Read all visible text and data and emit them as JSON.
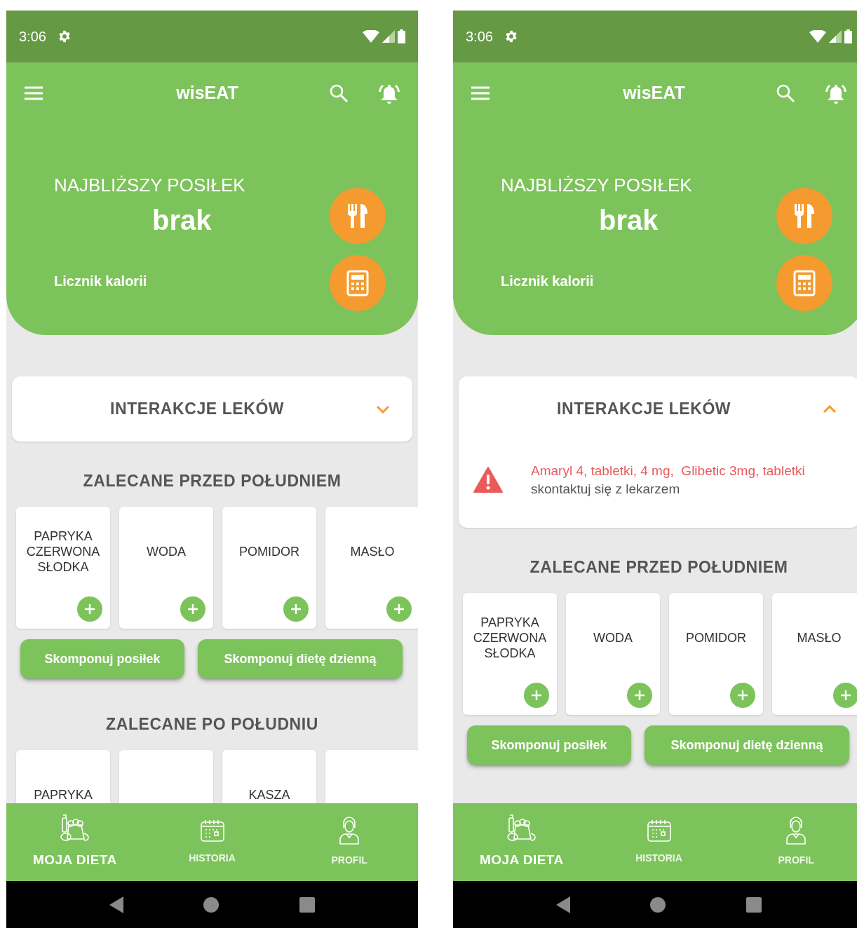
{
  "screens": [
    {
      "status_bar": {
        "time": "3:06"
      },
      "app_bar": {
        "title": "wisEAT"
      },
      "next_meal": {
        "label": "NAJBLIŻSZY POSIŁEK",
        "value": "brak"
      },
      "calorie_counter": {
        "label": "Licznik kalorii"
      },
      "drug_interactions": {
        "title": "INTERAKCJE LEKÓW",
        "expanded": false
      },
      "sections": [
        {
          "title": "ZALECANE PRZED POŁUDNIEM",
          "foods": [
            {
              "kind": "food",
              "name": "PAPRYKA CZERWONA SŁODKA"
            },
            {
              "kind": "food",
              "name": "WODA"
            },
            {
              "kind": "food",
              "name": "POMIDOR"
            },
            {
              "kind": "food",
              "name": "MASŁO"
            }
          ],
          "buttons": [
            "Skomponuj posiłek",
            "Skomponuj dietę dzienną"
          ]
        },
        {
          "title": "ZALECANE PO POŁUDNIU",
          "foods": [
            {
              "kind": "partial",
              "name": "PAPRYKA"
            },
            {
              "kind": "partial"
            },
            {
              "kind": "partial",
              "name": "KASZA"
            },
            {
              "kind": "partial"
            }
          ]
        }
      ],
      "bottom_nav": [
        {
          "label": "MOJA DIETA",
          "selected": true
        },
        {
          "label": "HISTORIA",
          "selected": false
        },
        {
          "label": "PROFIL",
          "selected": false
        }
      ]
    },
    {
      "status_bar": {
        "time": "3:06"
      },
      "app_bar": {
        "title": "wisEAT"
      },
      "next_meal": {
        "label": "NAJBLIŻSZY POSIŁEK",
        "value": "brak"
      },
      "calorie_counter": {
        "label": "Licznik kalorii"
      },
      "drug_interactions": {
        "title": "INTERAKCJE LEKÓW",
        "expanded": true,
        "warnings": [
          {
            "drugs": "Amaryl 4, tabletki, 4 mg,  Glibetic 3mg, tabletki",
            "advice": "skontaktuj się z lekarzem"
          }
        ]
      },
      "sections": [
        {
          "title": "ZALECANE PRZED POŁUDNIEM",
          "foods": [
            {
              "kind": "food",
              "name": "PAPRYKA CZERWONA SŁODKA"
            },
            {
              "kind": "food",
              "name": "WODA"
            },
            {
              "kind": "food",
              "name": "POMIDOR"
            },
            {
              "kind": "food",
              "name": "MASŁO"
            }
          ],
          "buttons": [
            "Skomponuj posiłek",
            "Skomponuj dietę dzienną"
          ]
        }
      ],
      "bottom_nav": [
        {
          "label": "MOJA DIETA",
          "selected": true
        },
        {
          "label": "HISTORIA",
          "selected": false
        },
        {
          "label": "PROFIL",
          "selected": false
        }
      ]
    }
  ]
}
